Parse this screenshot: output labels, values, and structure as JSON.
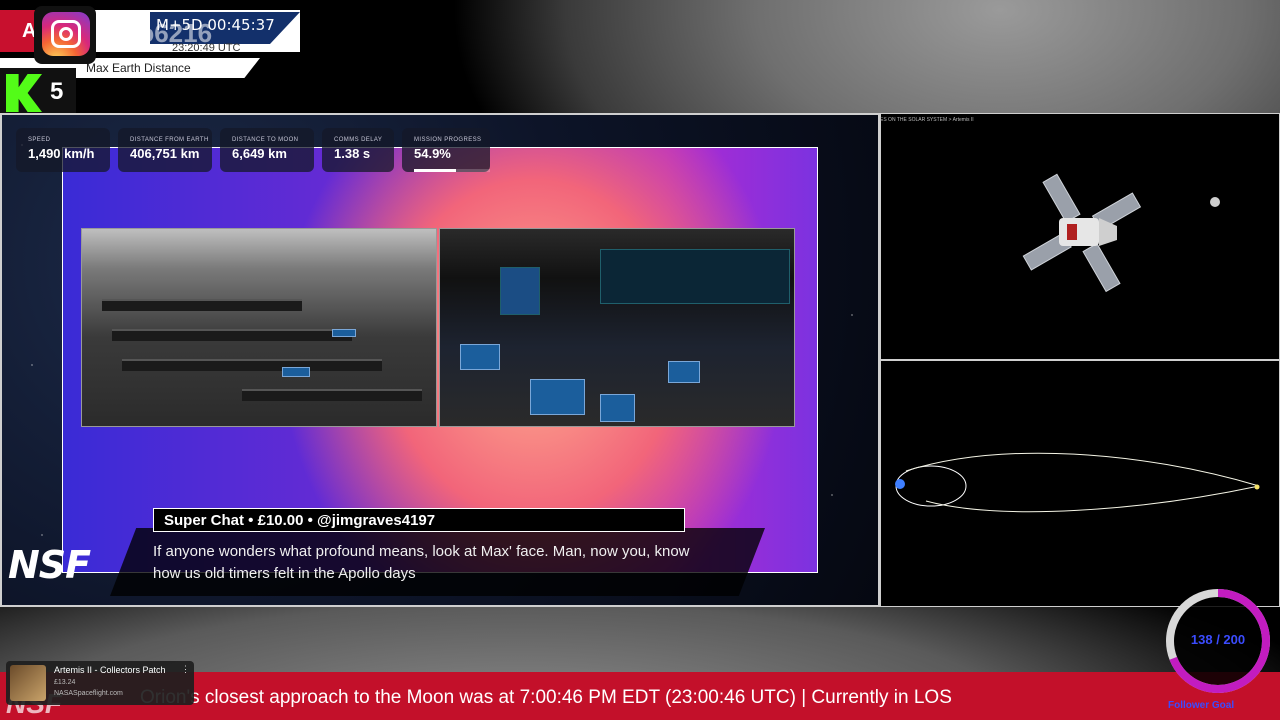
{
  "overlay": {
    "title_prefix": "A",
    "watermark_handle": "sbo6216",
    "mission_clock": "M+5D 00:45:37",
    "utc_time": "23:20:49 UTC",
    "subtitle": "Max Earth Distance",
    "kick_count": "5",
    "icons": [
      "instagram-icon",
      "kick-icon"
    ]
  },
  "stats": [
    {
      "label": "SPEED",
      "value": "1,490 km/h"
    },
    {
      "label": "DISTANCE FROM EARTH",
      "value": "406,751 km"
    },
    {
      "label": "DISTANCE TO MOON",
      "value": "6,649 km"
    },
    {
      "label": "COMMS DELAY",
      "value": "1.38 s"
    },
    {
      "label": "MISSION PROGRESS",
      "value": "54.9%",
      "progress": 0.549
    }
  ],
  "super_chat": {
    "header": "Super Chat  •  £10.00  •  @jimgraves4197",
    "message": "If anyone wonders what profound means, look at Max' face. Man, now you, know how us old timers felt in the Apollo days"
  },
  "branding": {
    "nsf_logo": "NSF"
  },
  "right_pane": {
    "breadcrumb": "ES ON THE SOLAR SYSTEM  >  Artemis II"
  },
  "ticker": {
    "text": "Orion's closest approach to the Moon was at 7:00:46 PM EDT (23:00:46 UTC) | Currently in LOS"
  },
  "yt_card": {
    "title": "Artemis II - Collectors Patch",
    "duration": "£13.24",
    "channel": "NASASpaceflight.com",
    "more": "⋮"
  },
  "follower_goal": {
    "value": "138 / 200",
    "label": "Follower Goal",
    "progress": 0.69,
    "colors": {
      "ring": "#c21cc0",
      "track": "#d8d8d8",
      "text": "#3b4cff"
    }
  },
  "colors": {
    "ticker": "#c3102a",
    "accent_red": "#c8102e",
    "kick_green": "#53fc18"
  }
}
